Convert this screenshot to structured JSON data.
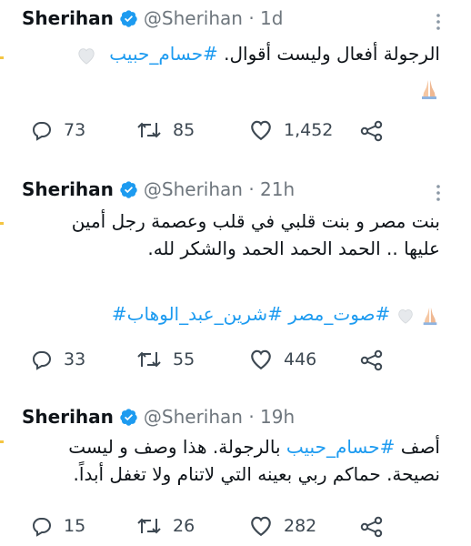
{
  "tweets": [
    {
      "name": "Sherihan",
      "handle": "@Sherihan",
      "time": "1d",
      "text_before": "الرجولة أفعال وليست أقوال. ",
      "hashtag": "#حسام_حبيب",
      "extra_line": "",
      "hashtag_line": "",
      "replies": "73",
      "retweets": "85",
      "likes": "1,452"
    },
    {
      "name": "Sherihan",
      "handle": "@Sherihan",
      "time": "21h",
      "line1": "بنت مصر و بنت قلبي في قلب وعصمة رجل أمين",
      "line2": "عليها .. الحمد الحمد الحمد والشكر لله.",
      "hashtags": "#صوت_مصر #شرين_عبد_الوهاب#",
      "replies": "33",
      "retweets": "55",
      "likes": "446"
    },
    {
      "name": "Sherihan",
      "handle": "@Sherihan",
      "time": "19h",
      "line1_start": "أصف ",
      "line1_hashtag": "#حسام_حبيب",
      "line1_end": " بالرجولة.  هذا وصف و ليست",
      "line2": "نصيحة.  حماكم ربي بعينه التي لاتنام ولا تغفل أبداً.",
      "replies": "15",
      "retweets": "26",
      "likes": "282"
    }
  ],
  "colors": {
    "accent": "#1d9bf0",
    "text": "#0f1419",
    "muted": "#6e767d"
  },
  "icons": [
    "verified-badge-icon",
    "more-icon",
    "reply-icon",
    "retweet-icon",
    "like-icon",
    "share-icon",
    "heart-emoji",
    "praying-hands-emoji"
  ]
}
